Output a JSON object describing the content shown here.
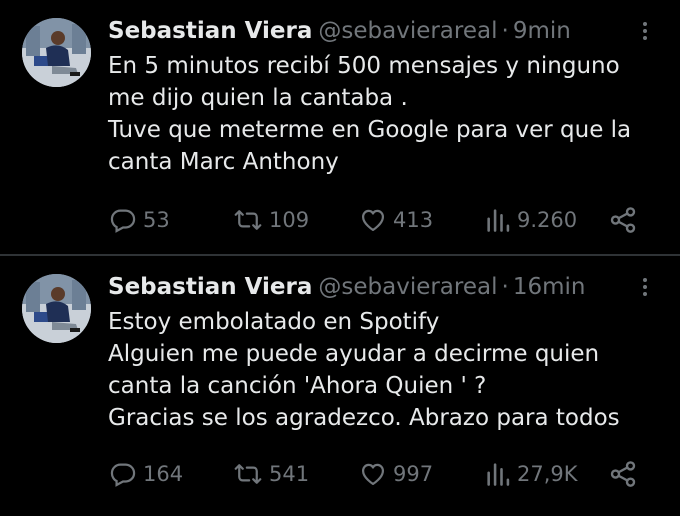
{
  "tweets": [
    {
      "author_name": "Sebastian Viera",
      "author_handle": "@sebavierareal",
      "separator": "·",
      "time": "9min",
      "lines": [
        "En 5 minutos recibí 500 mensajes y ninguno",
        "me dijo quien la cantaba ️.",
        "Tuve que meterme en Google para ver que la",
        "canta Marc Anthony"
      ],
      "replies": "53",
      "retweets": "109",
      "likes": "413",
      "views": "9.260"
    },
    {
      "author_name": "Sebastian Viera",
      "author_handle": "@sebavierareal",
      "separator": "·",
      "time": "16min",
      "lines": [
        "Estoy embolatado en Spotify",
        "Alguien me puede ayudar a decirme quien",
        "canta la canción 'Ahora Quien ' ?",
        "Gracias se los agradezco. Abrazo para todos"
      ],
      "replies": "164",
      "retweets": "541",
      "likes": "997",
      "views": "27,9K"
    }
  ],
  "icons": {
    "reply": "reply-icon",
    "retweet": "retweet-icon",
    "like": "heart-icon",
    "views": "views-chart-icon",
    "share": "share-icon",
    "more": "more-vertical-icon"
  },
  "colors": {
    "background": "#000000",
    "text": "#e7e9ea",
    "muted": "#71767b",
    "divider": "#2f3336"
  }
}
